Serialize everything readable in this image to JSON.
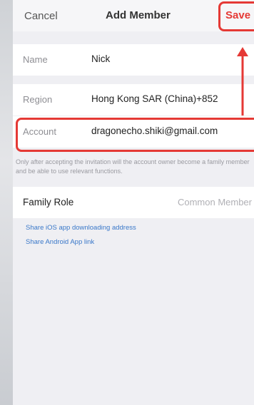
{
  "header": {
    "cancel_label": "Cancel",
    "title": "Add Member",
    "save_label": "Save"
  },
  "form": {
    "name": {
      "label": "Name",
      "value": "Nick"
    },
    "region": {
      "label": "Region",
      "value": "Hong Kong SAR (China)+852"
    },
    "account": {
      "label": "Account",
      "value": "dragonecho.shiki@gmail.com"
    },
    "hint": "Only after accepting the invitation will the account owner become a family member and be able to use relevant functions.",
    "family_role": {
      "label": "Family Role",
      "value": "Common Member"
    }
  },
  "links": {
    "ios": "Share iOS app downloading address",
    "android": "Share Android App link"
  },
  "colors": {
    "accent_red": "#e53935",
    "link_blue": "#3a78c9",
    "background": "#efeff3"
  },
  "icons": {
    "chevron": "chevron-right-icon",
    "arrow": "arrow-up-icon"
  }
}
